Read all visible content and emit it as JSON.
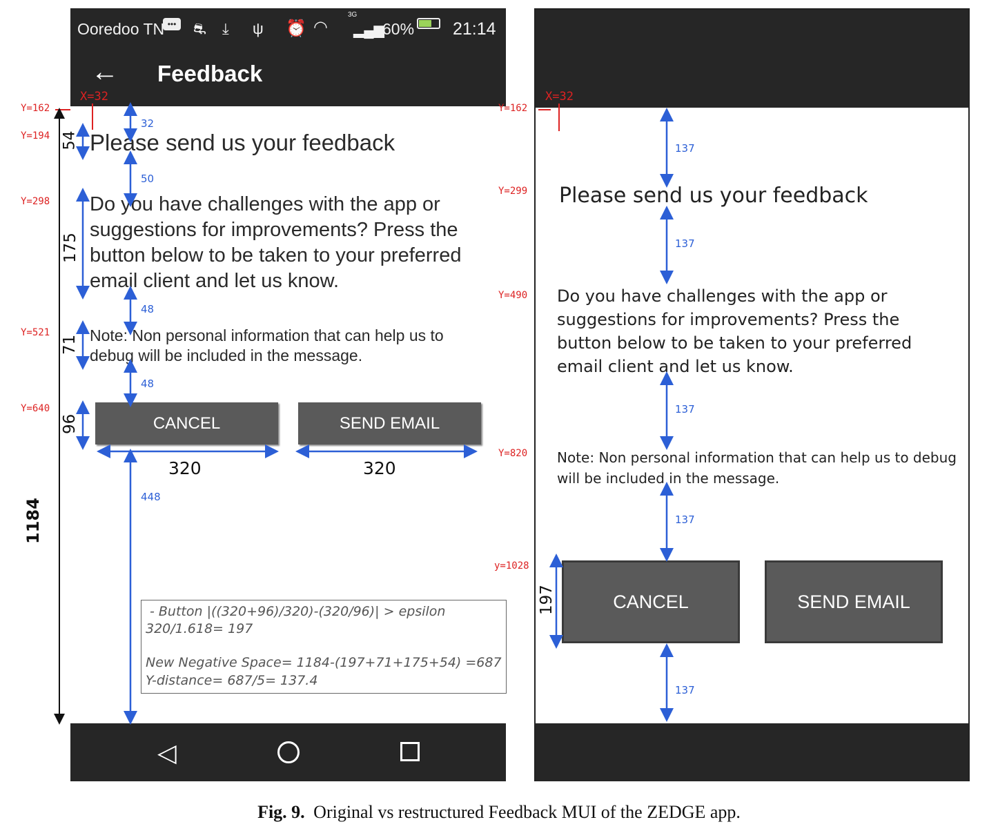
{
  "left": {
    "status": {
      "carrier": "Ooredoo TN",
      "network": "3G",
      "battery": "60%",
      "time": "21:14"
    },
    "toolbar": {
      "title": "Feedback"
    },
    "heading": "Please send us your feedback",
    "body": "Do you have challenges with the app or suggestions for improvements? Press the button below to be taken to your preferred email client and let us know.",
    "note": "Note: Non personal information that can help us to debug will be included in the message.",
    "cancel_label": "CANCEL",
    "send_label": "SEND EMAIL",
    "annotations": {
      "x32": "X=32",
      "y162": "Y=162",
      "y194": "Y=194",
      "y298": "Y=298",
      "y521": "Y=521",
      "y640": "Y=640",
      "h54": "54",
      "h175": "175",
      "h71": "71",
      "h96": "96",
      "h1184": "1184",
      "g32": "32",
      "g50": "50",
      "g48a": "48",
      "g48b": "48",
      "g448": "448",
      "w320a": "320",
      "w320b": "320"
    },
    "calc": {
      "line1": "- Button |((320+96)/320)-(320/96)| > epsilon",
      "line2": "320/1.618= 197",
      "line3": "New Negative Space= 1184-(197+71+175+54) =687",
      "line4": "Y-distance= 687/5= 137.4"
    }
  },
  "right": {
    "heading": "Please send us your feedback",
    "body": "Do you have challenges with the app or suggestions for improvements? Press the button below to be taken to your preferred email client and let us know.",
    "note": "Note: Non personal information that can help us to debug will be included in the message.",
    "cancel_label": "CANCEL",
    "send_label": "SEND EMAIL",
    "annotations": {
      "x32": "X=32",
      "y162": "Y=162",
      "y299": "Y=299",
      "y490": "Y=490",
      "y820": "Y=820",
      "y1028": "y=1028",
      "h197": "197",
      "g137a": "137",
      "g137b": "137",
      "g137c": "137",
      "g137d": "137",
      "g137e": "137"
    }
  },
  "caption": {
    "label": "Fig. 9.",
    "text": "Original vs restructured Feedback MUI of the ZEDGE app."
  }
}
